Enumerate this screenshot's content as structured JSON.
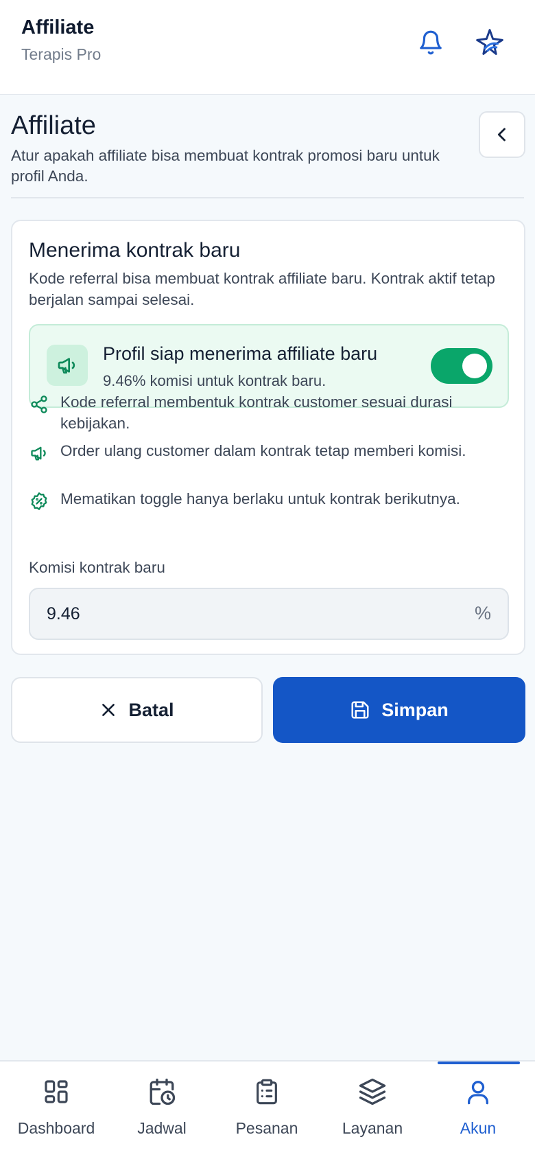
{
  "header": {
    "title": "Affiliate",
    "subtitle": "Terapis Pro",
    "icons": [
      "bell-icon",
      "brand-logo-icon"
    ]
  },
  "page": {
    "title": "Affiliate",
    "description": "Atur apakah affiliate bisa membuat kontrak promosi baru untuk profil Anda.",
    "back_icon": "chevron-left-icon"
  },
  "card": {
    "title": "Menerima kontrak baru",
    "description": "Kode referral bisa membuat kontrak affiliate baru. Kontrak aktif tetap berjalan sampai selesai.",
    "status": {
      "title": "Profil siap menerima affiliate baru",
      "subtitle": "9.46% komisi untuk kontrak baru.",
      "toggle_on": true,
      "icon": "megaphone-icon"
    },
    "bullets": [
      {
        "icon": "share-icon",
        "text": "Kode referral membentuk kontrak customer sesuai durasi kebijakan."
      },
      {
        "icon": "megaphone-icon",
        "text": "Order ulang customer dalam kontrak tetap memberi komisi."
      },
      {
        "icon": "discount-badge-icon",
        "text": "Mematikan toggle hanya berlaku untuk kontrak berikutnya."
      }
    ],
    "commission": {
      "label": "Komisi kontrak baru",
      "value": "9.46",
      "suffix": "%"
    }
  },
  "actions": {
    "cancel_label": "Batal",
    "save_label": "Simpan"
  },
  "nav": {
    "items": [
      {
        "label": "Dashboard",
        "icon": "dashboard-icon",
        "active": false
      },
      {
        "label": "Jadwal",
        "icon": "calendar-clock-icon",
        "active": false
      },
      {
        "label": "Pesanan",
        "icon": "clipboard-list-icon",
        "active": false
      },
      {
        "label": "Layanan",
        "icon": "layers-icon",
        "active": false
      },
      {
        "label": "Akun",
        "icon": "user-icon",
        "active": true
      }
    ]
  },
  "colors": {
    "primary": "#1456c6",
    "success": "#0aa66a",
    "success_bg": "#ebfaf2",
    "text": "#152033",
    "muted": "#3d4757"
  }
}
